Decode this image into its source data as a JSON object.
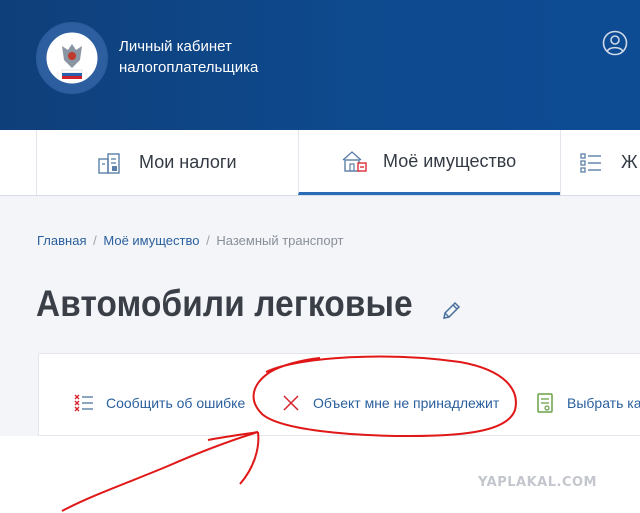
{
  "header": {
    "app_title": "Личный кабинет налогоплательщика",
    "emblem_text": "ФЕДЕРАЛЬНАЯ НАЛОГОВАЯ СЛУЖБА",
    "brand_color": "#0e4a8e",
    "user_icon": "user-icon"
  },
  "nav": {
    "tabs": [
      {
        "label": "Мои налоги",
        "icon": "taxes-icon",
        "active": false
      },
      {
        "label": "Моё имущество",
        "icon": "property-icon",
        "active": true
      },
      {
        "label": "Ж",
        "icon": "list-icon",
        "active": false
      }
    ]
  },
  "breadcrumb": {
    "items": [
      "Главная",
      "Моё имущество",
      "Наземный транспорт"
    ],
    "separator": "/"
  },
  "page": {
    "title": "Автомобили легковые",
    "edit_icon": "pencil-icon"
  },
  "actions": [
    {
      "label": "Сообщить об ошибке",
      "icon": "error-list-icon"
    },
    {
      "label": "Объект мне не принадлежит",
      "icon": "close-icon"
    },
    {
      "label": "Выбрать ка",
      "icon": "document-icon"
    }
  ],
  "colors": {
    "link": "#2a5f9e",
    "accent_red": "#d6202a",
    "annotation_red": "#e01818"
  },
  "watermark": "YAPLAKAL.COM"
}
